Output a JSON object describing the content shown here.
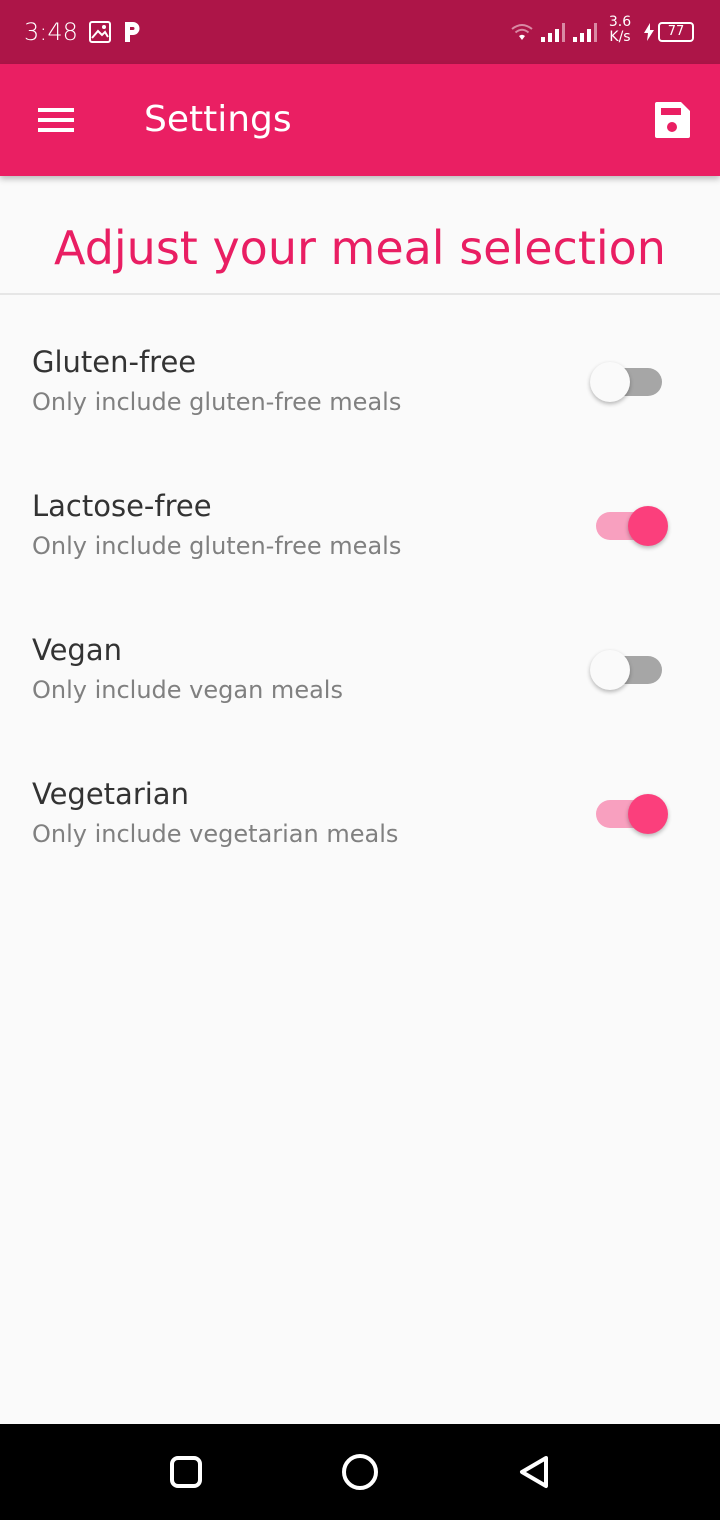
{
  "status_bar": {
    "time": "3:48",
    "speed_value": "3.6",
    "speed_unit": "K/s",
    "battery": "77",
    "icons": [
      "gallery-icon",
      "p-icon",
      "wifi-icon",
      "signal-icon",
      "signal-icon",
      "charging-icon",
      "battery-icon"
    ]
  },
  "app_bar": {
    "title": "Settings",
    "menu_icon": "menu-icon",
    "save_icon": "save-icon",
    "color": "#ea1f63"
  },
  "heading": "Adjust your meal selection",
  "settings": [
    {
      "title": "Gluten-free",
      "subtitle": "Only include gluten-free meals",
      "enabled": false
    },
    {
      "title": "Lactose-free",
      "subtitle": "Only include gluten-free meals",
      "enabled": true
    },
    {
      "title": "Vegan",
      "subtitle": "Only include vegan meals",
      "enabled": false
    },
    {
      "title": "Vegetarian",
      "subtitle": "Only include vegetarian meals",
      "enabled": true
    }
  ],
  "nav_bar": {
    "icons": [
      "recents-icon",
      "home-icon",
      "back-icon"
    ]
  },
  "colors": {
    "status_bar": "#ad1548",
    "accent": "#e91e63",
    "switch_on": "#fb3f7c",
    "switch_off": "#a6a6a6"
  }
}
